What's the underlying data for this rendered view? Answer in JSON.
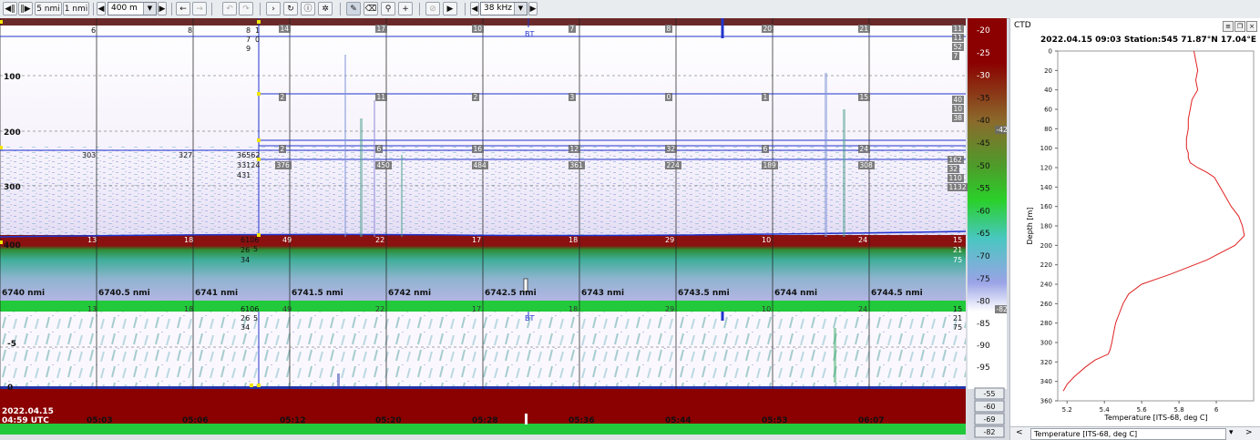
{
  "toolbar": {
    "btn_5nmi": "5 nmi",
    "btn_1nmi": "1 nmi",
    "range_value": "400 m",
    "freq_value": "38 kHz"
  },
  "echogram": {
    "upper_depth_ticks": [
      "100",
      "200",
      "300",
      "400"
    ],
    "lower_depth_ticks": [
      "-5",
      "0"
    ],
    "distance_labels": [
      "6740 nmi",
      "6740.5 nmi",
      "6741 nmi",
      "6741.5 nmi",
      "6742 nmi",
      "6742.5 nmi",
      "6743 nmi",
      "6743.5 nmi",
      "6744 nmi",
      "6744.5 nmi"
    ],
    "date_label": "2022.04.15",
    "time_labels": [
      "04:59 UTC",
      "05:03",
      "05:06",
      "05:12",
      "05:20",
      "05:28",
      "05:36",
      "05:44",
      "05:53",
      "06:07"
    ],
    "bt_label": "BT",
    "layer_row1": [
      "14",
      "17",
      "10",
      "7",
      "8",
      "20",
      "21"
    ],
    "layer_row2": [
      "2",
      "11",
      "2",
      "3",
      "0",
      "1",
      "15"
    ],
    "layer_row3": [
      "2",
      "6",
      "16",
      "12",
      "32",
      "6",
      "24"
    ],
    "layer_row4": [
      "376",
      "450",
      "484",
      "361",
      "224",
      "189",
      "308"
    ],
    "seabed_row": [
      "13",
      "18",
      "49",
      "22",
      "17",
      "18",
      "29",
      "10",
      "24"
    ],
    "sa_top": [
      "6",
      "8"
    ],
    "sa_mid": [
      "303",
      "327"
    ],
    "left_stack": [
      "36562",
      "33124",
      "431"
    ],
    "left_top": [
      "8",
      "7",
      "9"
    ],
    "left_zeros": [
      "1",
      "0"
    ],
    "seabed_left": [
      "6106",
      "26",
      "34"
    ],
    "seabed_left_small": [
      "5"
    ],
    "right_top": [
      "11",
      "11",
      "52",
      "7"
    ],
    "right_mid": [
      "40",
      "10",
      "38"
    ],
    "right_low": [
      "162",
      "32",
      "110",
      "1132"
    ],
    "right_seabed": [
      "15",
      "21",
      "75"
    ]
  },
  "colorscale": {
    "upper_ticks": [
      "-20",
      "-25",
      "-30",
      "-35",
      "-40",
      "-45",
      "-50",
      "-55",
      "-60",
      "-65",
      "-70",
      "-75",
      "-80"
    ],
    "upper_marker": "-42",
    "lower_marker": "-82",
    "lower_ticks": [
      "-85",
      "-90",
      "-95"
    ],
    "bottom_boxes": [
      "-55",
      "-60",
      "-69",
      "-82"
    ]
  },
  "ctd": {
    "title": "CTD",
    "header": "2022.04.15 09:03   Station:545   71.87°N 17.04°E",
    "xlabel": "Temperature [ITS-68, deg C]",
    "ylabel": "Depth [m]",
    "dropdown": "Temperature [ITS-68, deg C]"
  },
  "chart_data": {
    "type": "line",
    "title": "2022.04.15 09:03   Station:545   71.87°N 17.04°E",
    "xlabel": "Temperature [ITS-68, deg C]",
    "ylabel": "Depth [m]",
    "xlim": [
      5.15,
      6.2
    ],
    "ylim": [
      360,
      0
    ],
    "xticks": [
      "5.2",
      "5.4",
      "5.6",
      "5.8",
      "6"
    ],
    "yticks": [
      "0",
      "20",
      "40",
      "60",
      "80",
      "100",
      "120",
      "140",
      "160",
      "180",
      "200",
      "220",
      "240",
      "260",
      "280",
      "300",
      "320",
      "340",
      "360"
    ],
    "series": [
      {
        "color": "#e02020",
        "x": [
          5.88,
          5.89,
          5.9,
          5.89,
          5.9,
          5.87,
          5.86,
          5.85,
          5.85,
          5.84,
          5.84,
          5.85,
          5.85,
          5.86,
          5.9,
          5.95,
          5.99,
          6.02,
          6.05,
          6.08,
          6.12,
          6.14,
          6.15,
          6.1,
          5.95,
          5.75,
          5.6,
          5.53,
          5.5,
          5.48,
          5.46,
          5.45,
          5.44,
          5.43,
          5.42,
          5.35,
          5.3,
          5.24,
          5.2,
          5.18
        ],
        "y": [
          0,
          10,
          20,
          30,
          40,
          50,
          60,
          70,
          80,
          90,
          100,
          105,
          110,
          115,
          120,
          125,
          130,
          140,
          150,
          160,
          170,
          180,
          190,
          200,
          215,
          230,
          240,
          250,
          260,
          270,
          280,
          290,
          300,
          308,
          312,
          318,
          325,
          335,
          343,
          350
        ]
      }
    ]
  }
}
